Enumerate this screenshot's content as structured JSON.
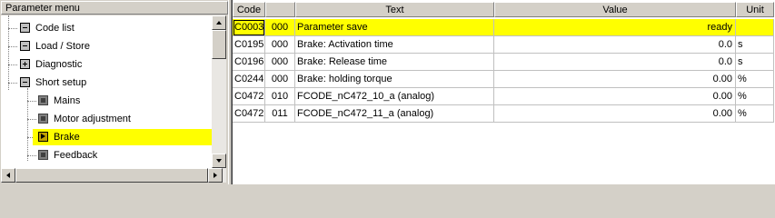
{
  "left_panel": {
    "title": "Parameter menu",
    "tree": [
      {
        "label": "Code list"
      },
      {
        "label": "Load / Store"
      },
      {
        "label": "Diagnostic"
      },
      {
        "label": "Short setup"
      },
      {
        "label": "Mains"
      },
      {
        "label": "Motor adjustment"
      },
      {
        "label": "Brake"
      },
      {
        "label": "Feedback"
      }
    ],
    "selected": "Brake"
  },
  "grid": {
    "columns": [
      "Code",
      "Text",
      "Value",
      "Unit"
    ],
    "rows": [
      {
        "code": "C0003",
        "index": "000",
        "text": "Parameter save",
        "value": "ready",
        "unit": ""
      },
      {
        "code": "C0195",
        "index": "000",
        "text": "Brake: Activation time",
        "value": "0.0",
        "unit": "s"
      },
      {
        "code": "C0196",
        "index": "000",
        "text": "Brake: Release time",
        "value": "0.0",
        "unit": "s"
      },
      {
        "code": "C0244",
        "index": "000",
        "text": "Brake: holding torque",
        "value": "0.00",
        "unit": "%"
      },
      {
        "code": "C0472",
        "index": "010",
        "text": "FCODE_nC472_10_a (analog)",
        "value": "0.00",
        "unit": "%"
      },
      {
        "code": "C0472",
        "index": "011",
        "text": "FCODE_nC472_11_a (analog)",
        "value": "0.00",
        "unit": "%"
      }
    ],
    "highlight_color": "#ffff00"
  }
}
